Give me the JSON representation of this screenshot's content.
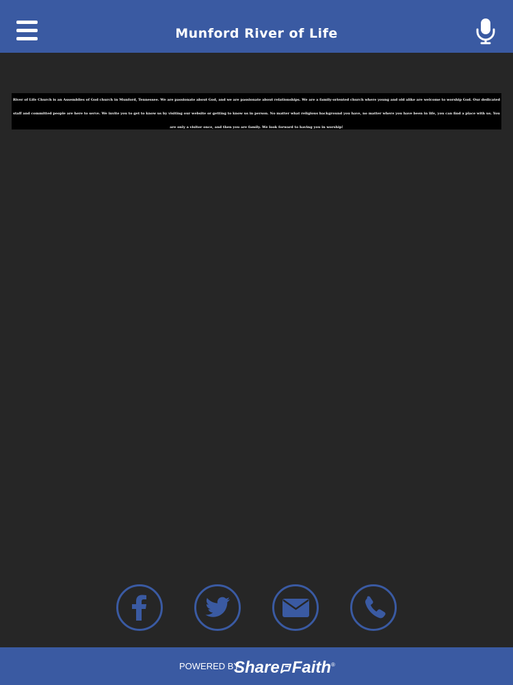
{
  "header": {
    "title": "Munford River of Life",
    "menu_icon": "hamburger-menu-icon",
    "mic_icon": "microphone-icon"
  },
  "content": {
    "text": "River of Life Church is an Assemblies of God church in Munford, Tennessee.  We are passionate about God, and we are passionate about relationships. We are a family-oriented church where young and old alike are welcome to worship God.  Our dedicated staff and committed people are here to serve.  We invite you to get to know us by visiting our website or getting to know us in person. No matter what religious background you have, no matter where you have been in life, you can find a place with us. You are only a visitor once, and then you are family. We look forward to having you in worship!"
  },
  "social": {
    "buttons": [
      {
        "icon": "facebook-icon"
      },
      {
        "icon": "twitter-icon"
      },
      {
        "icon": "email-icon"
      },
      {
        "icon": "phone-icon"
      }
    ]
  },
  "footer": {
    "powered_by": "POWERED BY",
    "brand_part1": "Share",
    "brand_part2": "Faith",
    "brand_reg": "®"
  },
  "colors": {
    "header_bg": "#3a5aa2",
    "page_bg": "#262626",
    "content_bg": "#000000",
    "accent": "#3a5aa2",
    "text": "#ffffff"
  }
}
